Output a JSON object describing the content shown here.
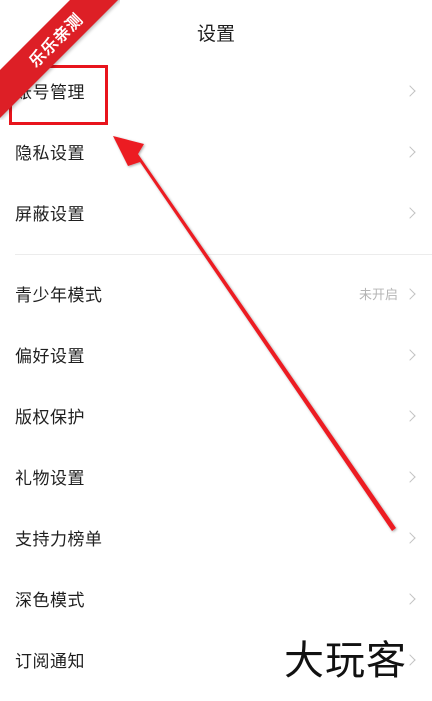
{
  "header": {
    "title": "设置"
  },
  "badge": {
    "text": "乐乐亲测"
  },
  "watermark": {
    "text": "大玩客"
  },
  "colors": {
    "accent_red": "#e8141c",
    "text_primary": "#1f1f1f",
    "text_secondary": "#b5b5b5",
    "chevron": "#c2c2c2"
  },
  "groups": [
    {
      "items": [
        {
          "label": "账号管理",
          "value": ""
        },
        {
          "label": "隐私设置",
          "value": ""
        },
        {
          "label": "屏蔽设置",
          "value": ""
        }
      ]
    },
    {
      "items": [
        {
          "label": "青少年模式",
          "value": "未开启"
        },
        {
          "label": "偏好设置",
          "value": ""
        },
        {
          "label": "版权保护",
          "value": ""
        },
        {
          "label": "礼物设置",
          "value": ""
        },
        {
          "label": "支持力榜单",
          "value": ""
        },
        {
          "label": "深色模式",
          "value": ""
        },
        {
          "label": "订阅通知",
          "value": ""
        }
      ]
    }
  ]
}
